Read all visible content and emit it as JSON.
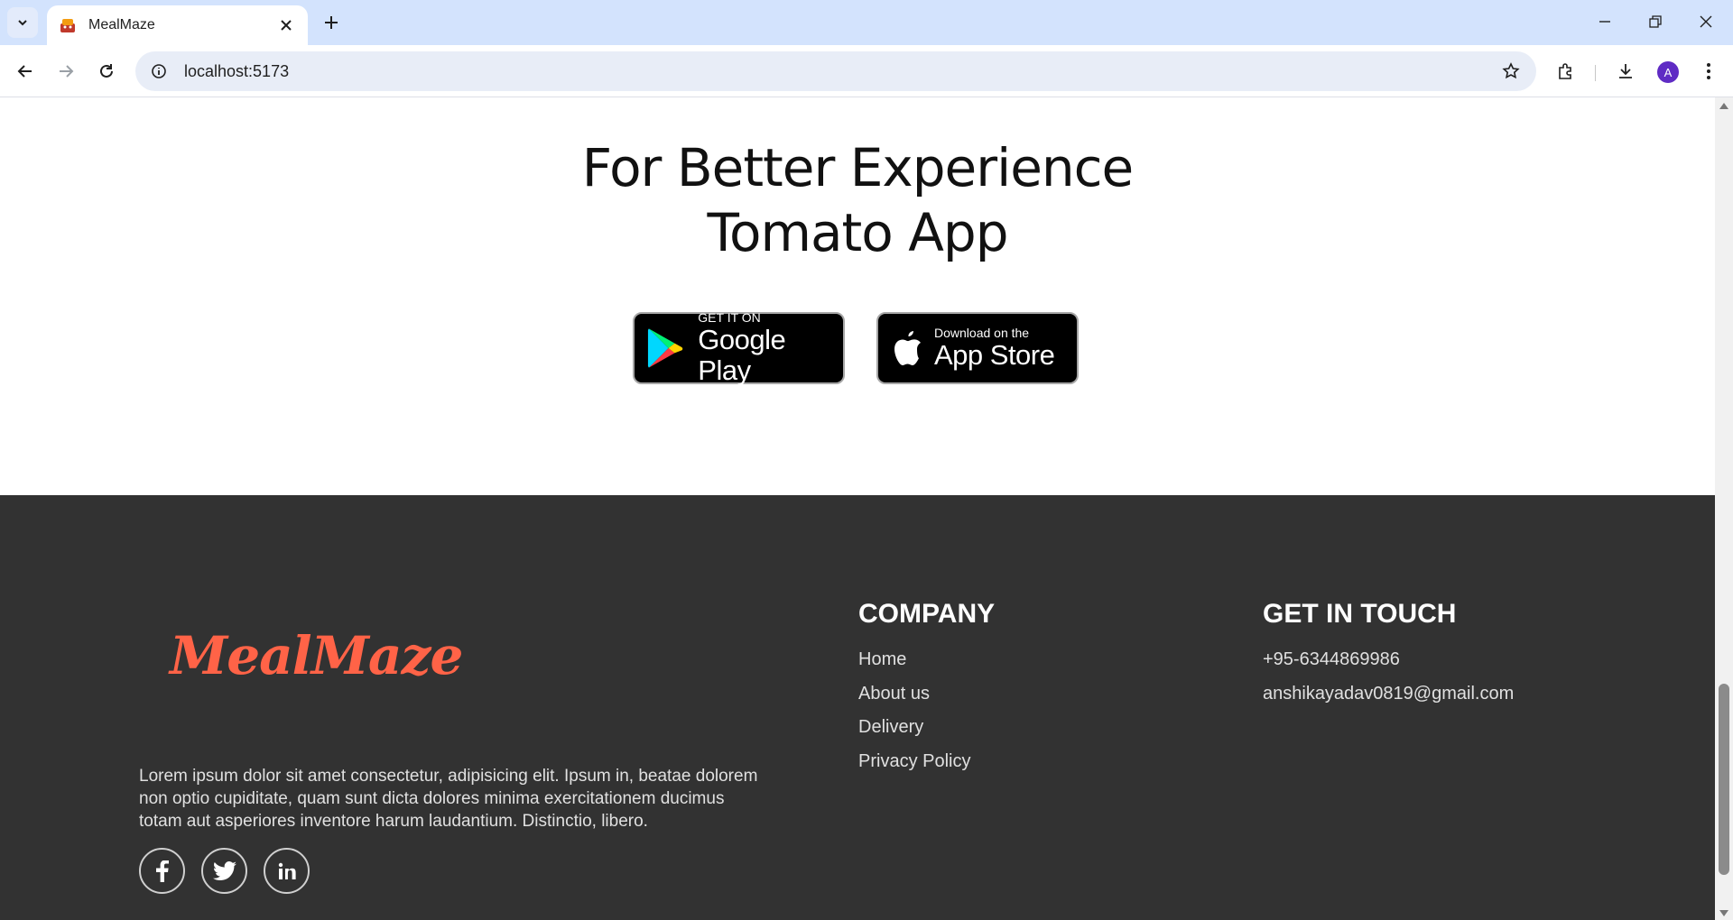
{
  "browser": {
    "tab_title": "MealMaze",
    "url": "localhost:5173",
    "profile_initial": "A"
  },
  "app_promo": {
    "title_line1": "For Better Experience",
    "title_line2": "Tomato App",
    "google_play": {
      "small": "GET IT ON",
      "big": "Google Play"
    },
    "app_store": {
      "small": "Download on the",
      "big": "App Store"
    }
  },
  "footer": {
    "logo": "MealMaze",
    "about": "Lorem ipsum dolor sit amet consectetur, adipisicing elit. Ipsum in, beatae dolorem non optio cupiditate, quam sunt dicta dolores minima exercitationem ducimus totam aut asperiores inventore harum laudantium. Distinctio, libero.",
    "socials": [
      "facebook-icon",
      "twitter-icon",
      "linkedin-icon"
    ],
    "company": {
      "title": "COMPANY",
      "links": [
        "Home",
        "About us",
        "Delivery",
        "Privacy Policy"
      ]
    },
    "contact": {
      "title": "GET IN TOUCH",
      "phone": "+95-6344869986",
      "email": "anshikayadav0819@gmail.com"
    }
  },
  "colors": {
    "accent": "#ff6347",
    "footer_bg": "#323232",
    "tabbar_bg": "#d3e3fd"
  }
}
